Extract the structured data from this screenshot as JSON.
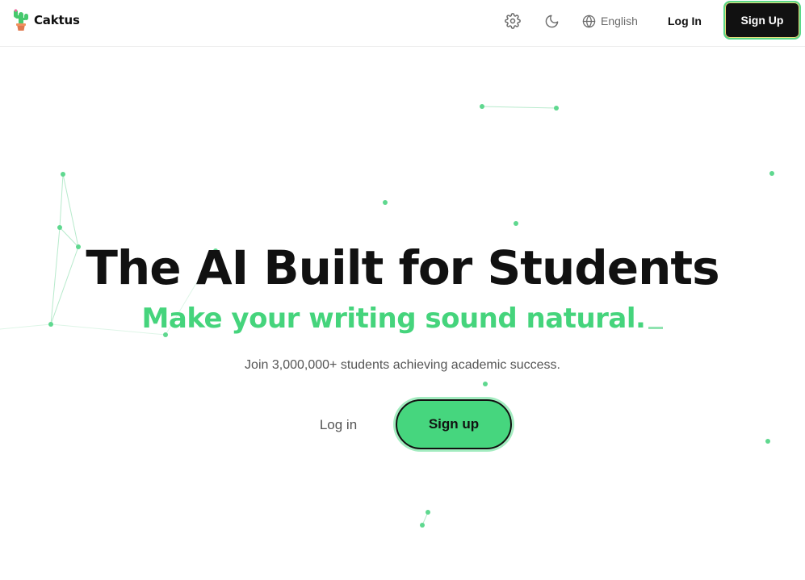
{
  "header": {
    "brand": "Caktus",
    "language": "English",
    "login_label": "Log In",
    "signup_label": "Sign Up",
    "icons": {
      "settings": "gear-icon",
      "theme": "moon-icon",
      "language": "globe-icon"
    }
  },
  "hero": {
    "title": "The AI Built for Students",
    "subtitle": "Make your writing sound natural.",
    "tagline": "Join 3,000,000+ students achieving academic success.",
    "login_label": "Log in",
    "signup_label": "Sign up"
  },
  "colors": {
    "accent": "#46d67e",
    "accent_light": "#a3ecc0",
    "text": "#111111",
    "muted": "#555555",
    "dark_button": "#111111"
  }
}
